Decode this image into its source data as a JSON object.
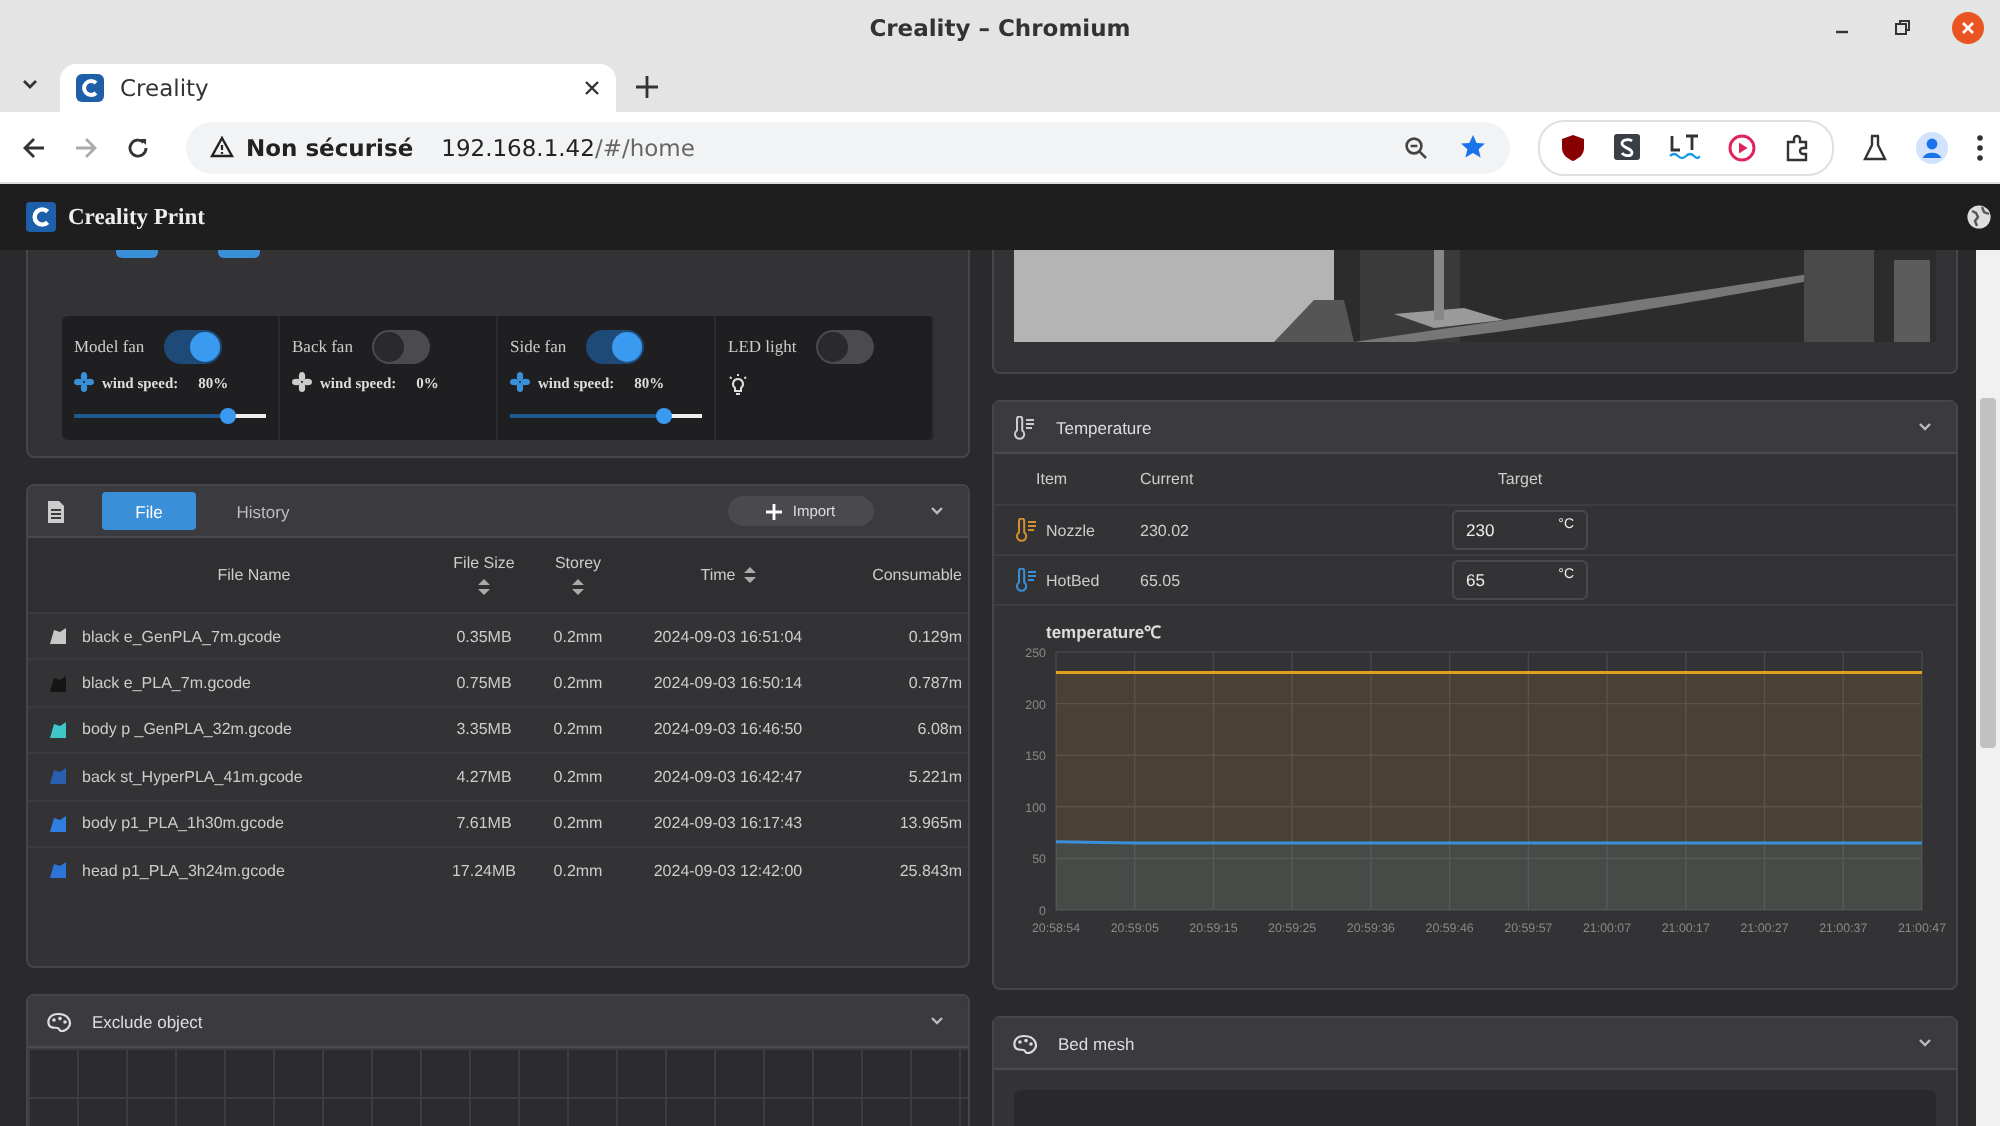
{
  "window": {
    "title": "Creality – Chromium"
  },
  "tabs": [
    {
      "label": "Creality",
      "selected": true
    }
  ],
  "address_bar": {
    "security": "Non sécurisé",
    "host": "192.168.1.42",
    "path": "/#/home"
  },
  "app": {
    "title": "Creality Print"
  },
  "fans": [
    {
      "kind": "fan",
      "name": "Model fan",
      "on": true,
      "speed_label": "wind speed:",
      "speed": "80%",
      "level": 0.8
    },
    {
      "kind": "fan",
      "name": "Back fan",
      "on": false,
      "speed_label": "wind speed:",
      "speed": "0%"
    },
    {
      "kind": "fan",
      "name": "Side fan",
      "on": true,
      "speed_label": "wind speed:",
      "speed": "80%",
      "level": 0.8
    },
    {
      "kind": "light",
      "name": "LED light",
      "on": false
    }
  ],
  "files": {
    "tabs": [
      {
        "label": "File",
        "selected": true
      },
      {
        "label": "History",
        "selected": false
      }
    ],
    "import_button": "Import",
    "columns": [
      {
        "label": "File Name",
        "sortable": false
      },
      {
        "label": "File Size",
        "sortable": true
      },
      {
        "label": "Storey",
        "sortable": true
      },
      {
        "label": "Time",
        "sortable": true
      },
      {
        "label": "Consumable",
        "sortable": false
      }
    ],
    "rows": [
      {
        "name": "black e_GenPLA_7m.gcode",
        "size": "0.35MB",
        "storey": "0.2mm",
        "time": "2024-09-03 16:51:04",
        "consumable": "0.129m",
        "color": "#c8c8c8"
      },
      {
        "name": "black e_PLA_7m.gcode",
        "size": "0.75MB",
        "storey": "0.2mm",
        "time": "2024-09-03 16:50:14",
        "consumable": "0.787m",
        "color": "#151515"
      },
      {
        "name": "body p _GenPLA_32m.gcode",
        "size": "3.35MB",
        "storey": "0.2mm",
        "time": "2024-09-03 16:46:50",
        "consumable": "6.08m",
        "color": "#3fc6c8"
      },
      {
        "name": "back st_HyperPLA_41m.gcode",
        "size": "4.27MB",
        "storey": "0.2mm",
        "time": "2024-09-03 16:42:47",
        "consumable": "5.221m",
        "color": "#2a5fb0"
      },
      {
        "name": "body p1_PLA_1h30m.gcode",
        "size": "7.61MB",
        "storey": "0.2mm",
        "time": "2024-09-03 16:17:43",
        "consumable": "13.965m",
        "color": "#2f7ee0"
      },
      {
        "name": "head p1_PLA_3h24m.gcode",
        "size": "17.24MB",
        "storey": "0.2mm",
        "time": "2024-09-03 12:42:00",
        "consumable": "25.843m",
        "color": "#2d74d8"
      }
    ]
  },
  "exclude_object": {
    "title": "Exclude object"
  },
  "temperature": {
    "title": "Temperature",
    "columns": [
      "Item",
      "Current",
      "Target"
    ],
    "rows": [
      {
        "name": "Nozzle",
        "current": "230.02",
        "target": "230",
        "unit": "°C",
        "color": "#d4902a"
      },
      {
        "name": "HotBed",
        "current": "65.05",
        "target": "65",
        "unit": "°C",
        "color": "#3a8fd9"
      }
    ],
    "chart_data": {
      "type": "area",
      "title": "temperature℃",
      "categories": [
        "20:58:54",
        "20:59:05",
        "20:59:15",
        "20:59:25",
        "20:59:36",
        "20:59:46",
        "20:59:57",
        "21:00:07",
        "21:00:17",
        "21:00:27",
        "21:00:37",
        "21:00:47"
      ],
      "series": [
        {
          "color": "#e0a020",
          "values": [
            230,
            230,
            230,
            230,
            230,
            230,
            230,
            230,
            230,
            230,
            230,
            230
          ]
        },
        {
          "color": "#3a8fd9",
          "values": [
            66,
            65,
            65,
            65,
            65,
            65,
            65,
            65,
            65,
            65,
            65,
            65
          ]
        }
      ],
      "grid": true,
      "ylim": [
        0,
        250
      ],
      "yticks": [
        0,
        50,
        100,
        150,
        200,
        250
      ]
    }
  },
  "bed_mesh": {
    "title": "Bed mesh"
  }
}
